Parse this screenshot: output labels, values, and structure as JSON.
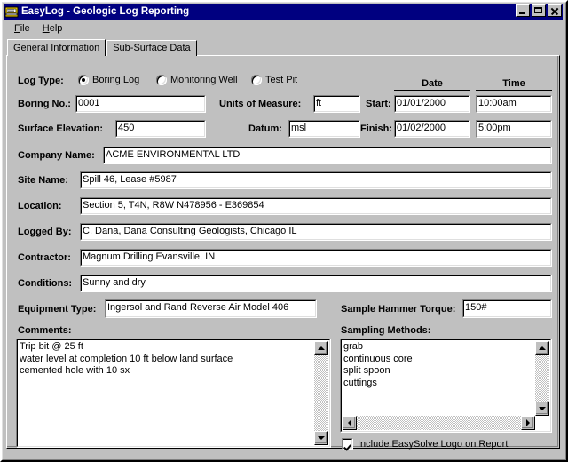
{
  "window": {
    "title": "EasyLog - Geologic Log Reporting",
    "icon": "app-document-icon",
    "colors": {
      "titlebar": "#000080",
      "face": "#c0c0c0",
      "field": "#ffffff"
    },
    "buttons": {
      "minimize": "Minimize",
      "maximize": "Maximize",
      "close": "Close"
    }
  },
  "menu": {
    "items": [
      {
        "label": "File",
        "accel": "F"
      },
      {
        "label": "Help",
        "accel": "H"
      }
    ]
  },
  "tabs": {
    "items": [
      {
        "label": "General Information",
        "active": true
      },
      {
        "label": "Sub-Surface Data",
        "active": false
      }
    ]
  },
  "form": {
    "log_type": {
      "label": "Log Type:",
      "options": [
        {
          "label": "Boring Log",
          "selected": true
        },
        {
          "label": "Monitoring Well",
          "selected": false
        },
        {
          "label": "Test Pit",
          "selected": false
        }
      ]
    },
    "column_headers": {
      "date": "Date",
      "time": "Time"
    },
    "fields": [
      {
        "key": "boring_no",
        "label": "Boring No.:",
        "value": "0001"
      },
      {
        "key": "units_of_measure",
        "label": "Units of Measure:",
        "value": "ft"
      },
      {
        "key": "start_label",
        "label": "Start:",
        "value": ""
      },
      {
        "key": "start_date",
        "label": "",
        "value": "01/01/2000"
      },
      {
        "key": "start_time",
        "label": "",
        "value": "10:00am"
      },
      {
        "key": "surface_elev",
        "label": "Surface Elevation:",
        "value": "450"
      },
      {
        "key": "datum",
        "label": "Datum:",
        "value": "msl"
      },
      {
        "key": "finish_label",
        "label": "Finish:",
        "value": ""
      },
      {
        "key": "finish_date",
        "label": "",
        "value": "01/02/2000"
      },
      {
        "key": "finish_time",
        "label": "",
        "value": "5:00pm"
      },
      {
        "key": "company_name",
        "label": "Company Name:",
        "value": "ACME ENVIRONMENTAL LTD"
      },
      {
        "key": "site_name",
        "label": "Site Name:",
        "value": "Spill 46,  Lease #5987"
      },
      {
        "key": "location",
        "label": "Location:",
        "value": "Section 5, T4N, R8W       N478956 - E369854"
      },
      {
        "key": "logged_by",
        "label": "Logged By:",
        "value": "C. Dana,  Dana Consulting Geologists, Chicago IL"
      },
      {
        "key": "contractor",
        "label": "Contractor:",
        "value": "Magnum Drilling    Evansville, IN"
      },
      {
        "key": "conditions",
        "label": "Conditions:",
        "value": "Sunny and dry"
      },
      {
        "key": "equipment_type",
        "label": "Equipment Type:",
        "value": "Ingersol and Rand Reverse Air  Model 406"
      },
      {
        "key": "hammer_torque",
        "label": "Sample Hammer Torque:",
        "value": "150#"
      }
    ],
    "comments": {
      "label": "Comments:",
      "lines": [
        "Trip bit @ 25 ft",
        "water level at completion 10 ft below land surface",
        "cemented hole with 10 sx"
      ]
    },
    "sampling_methods": {
      "label": "Sampling Methods:",
      "items": [
        "grab",
        "continuous core",
        "split spoon",
        "cuttings"
      ]
    },
    "include_logo": {
      "label": "Include EasySolve Logo on Report",
      "checked": true
    }
  },
  "scrollbars": {
    "up_arrow": "scroll-up-arrow-icon",
    "down_arrow": "scroll-down-arrow-icon",
    "left_arrow": "scroll-left-arrow-icon",
    "right_arrow": "scroll-right-arrow-icon"
  }
}
